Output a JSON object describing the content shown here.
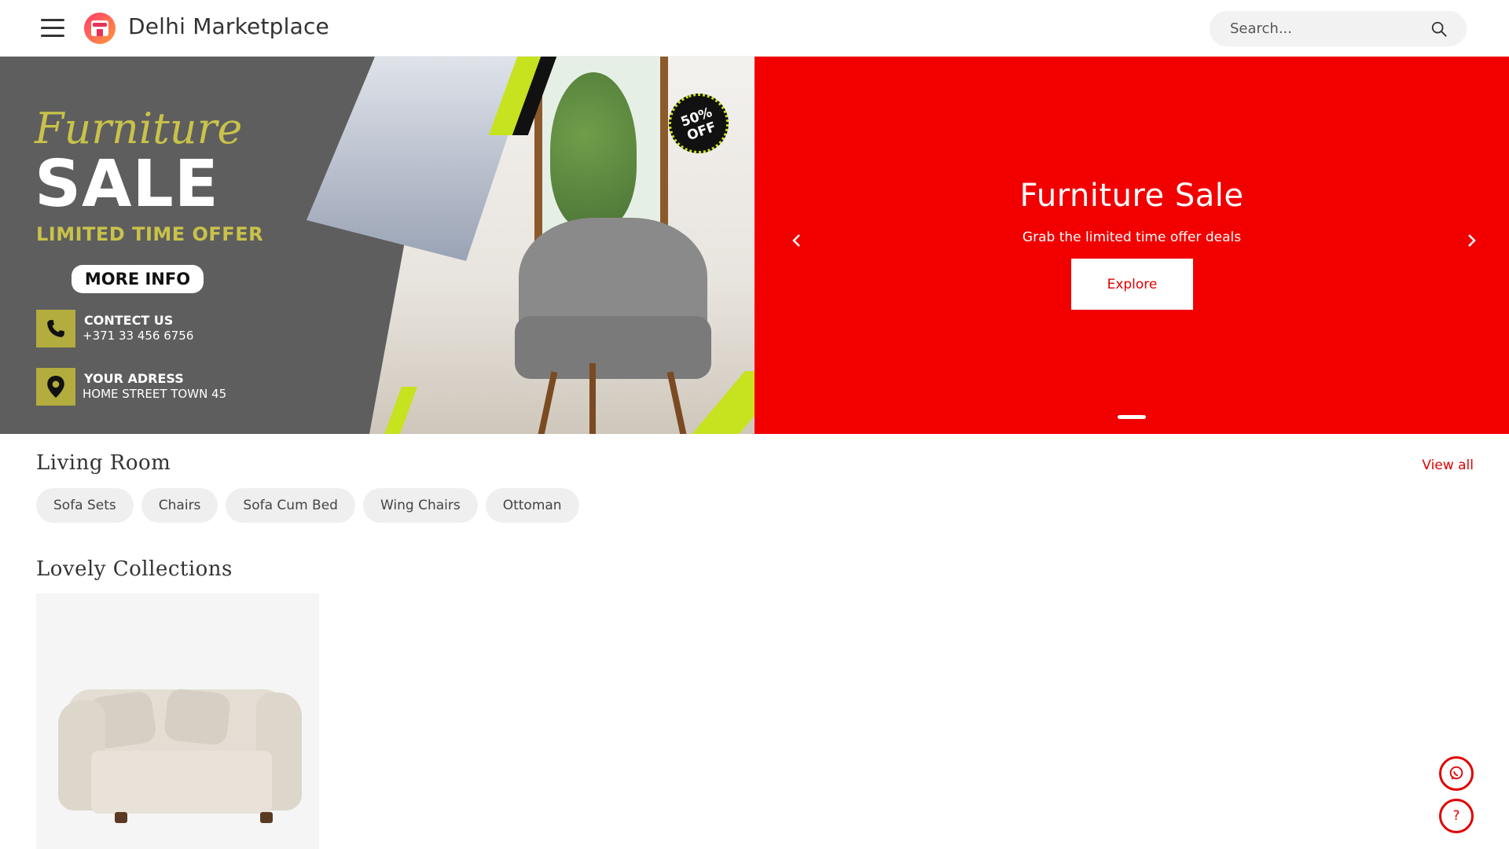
{
  "header": {
    "brand": "Delhi Marketplace",
    "search_placeholder": "Search...",
    "menu_icon": "hamburger-menu-icon",
    "search_icon": "search-icon"
  },
  "promo": {
    "script_title": "Furniture",
    "sale": "SALE",
    "offer": "LIMITED TIME OFFER",
    "more_info": "MORE INFO",
    "badge_line1": "50%",
    "badge_line2": "OFF",
    "contact_label": "CONTECT US",
    "contact_value": "+371 33 456 6756",
    "address_label": "YOUR ADRESS",
    "address_value": "HOME STREET TOWN 45"
  },
  "hero": {
    "title": "Furniture Sale",
    "subtitle": "Grab the limited time offer deals",
    "cta": "Explore",
    "background": "#f20000"
  },
  "living_room": {
    "title": "Living Room",
    "view_all": "View all",
    "chips": [
      "Sofa Sets",
      "Chairs",
      "Sofa Cum Bed",
      "Wing Chairs",
      "Ottoman"
    ]
  },
  "collections": {
    "title": "Lovely Collections"
  },
  "floating": {
    "whatsapp_icon": "whatsapp-icon",
    "help_label": "?"
  }
}
